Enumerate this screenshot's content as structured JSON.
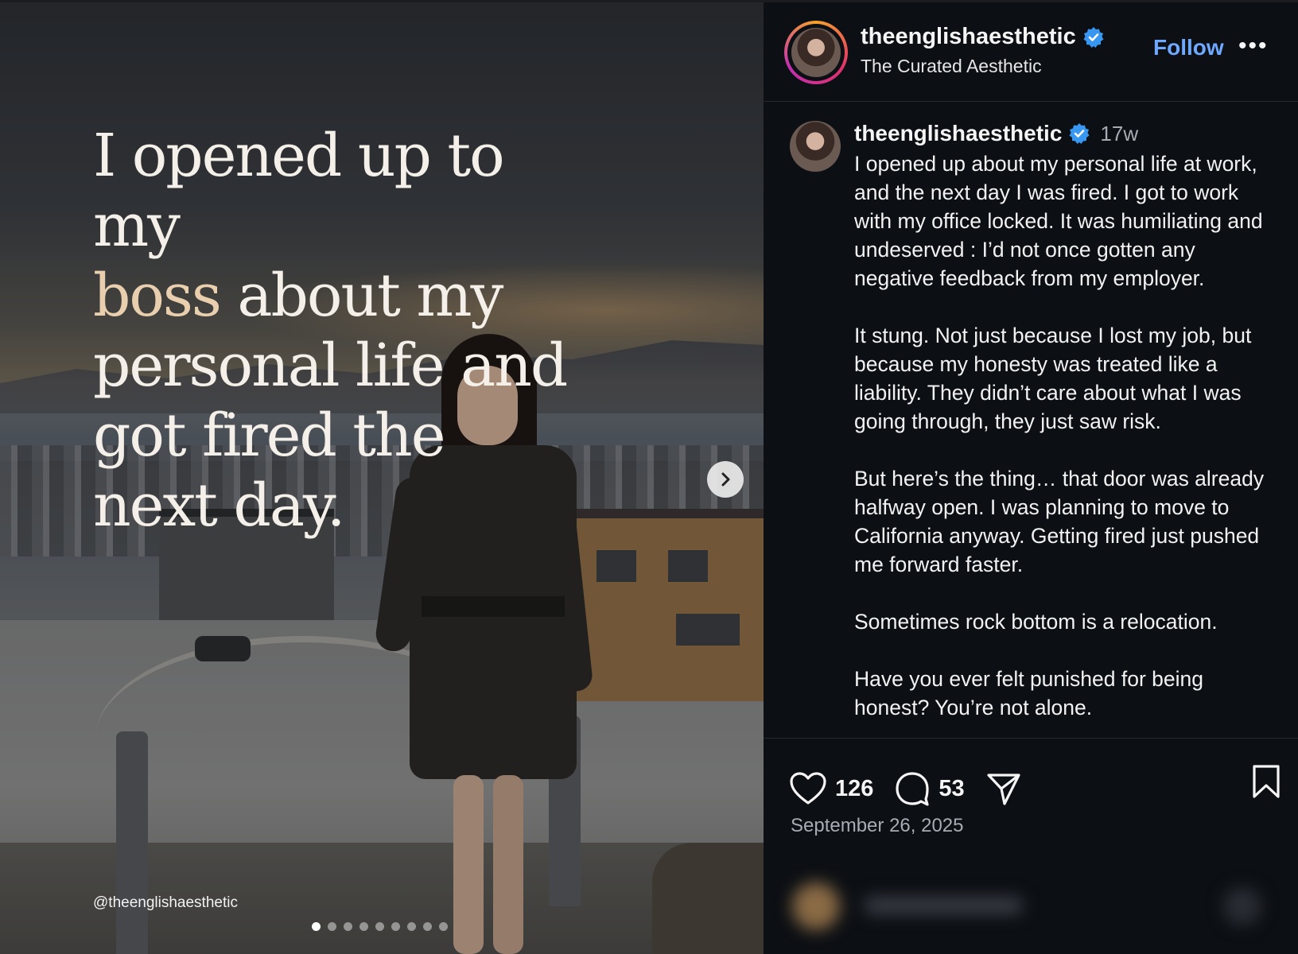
{
  "media": {
    "headline_line1": "I opened up to my",
    "headline_accent": "boss",
    "headline_line2_rest": " about my",
    "headline_line3": "personal life and",
    "headline_line4": "got fired the",
    "headline_line5": "next day.",
    "watermark": "@theenglishaesthetic",
    "carousel_total": 9,
    "carousel_active": 1,
    "accent_color": "#e9cfae"
  },
  "header": {
    "username": "theenglishaesthetic",
    "subtitle": "The Curated Aesthetic",
    "follow_label": "Follow",
    "more_label": "•••",
    "follow_color": "#6fa8ff"
  },
  "caption": {
    "username": "theenglishaesthetic",
    "time": "17w",
    "text": "I opened up about my personal life at work, and the next day I was fired. I got to work with my office locked. It was humiliating and undeserved : I’d not once gotten any negative feedback from my employer.\n\nIt stung. Not just because I lost my job, but because my honesty was treated like a liability. They didn’t care about what I was going through, they just saw risk.\n\nBut here’s the thing… that door was already halfway open. I was planning to move to California anyway. Getting fired just pushed me forward faster.\n\nSometimes rock bottom is a relocation.\n\nHave you ever felt punished for being honest? You’re not alone."
  },
  "actions": {
    "like_count": "126",
    "comment_count": "53",
    "icons": [
      "heart-icon",
      "comment-icon",
      "share-icon",
      "bookmark-icon"
    ]
  },
  "date": "September 26, 2025"
}
